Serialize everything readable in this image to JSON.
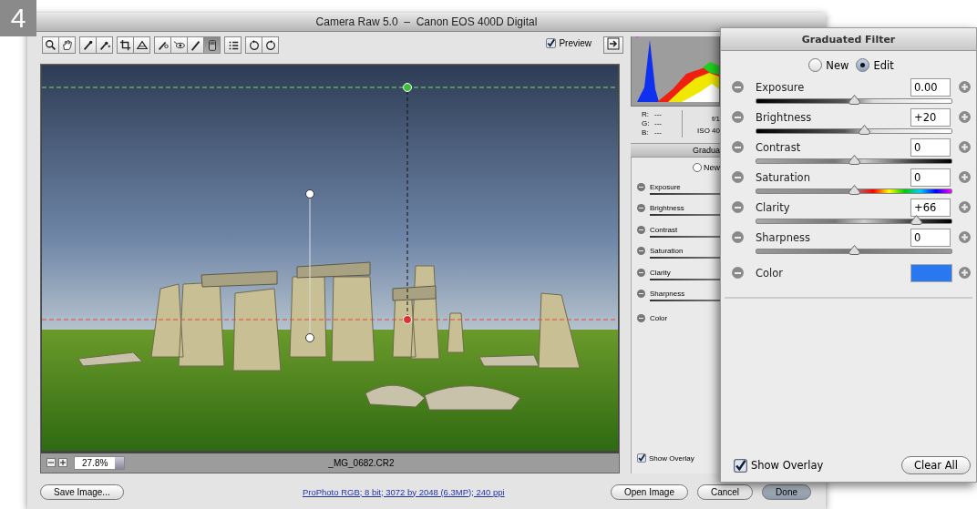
{
  "step_badge": "4",
  "window": {
    "title": "Camera Raw 5.0  –  Canon EOS 400D Digital"
  },
  "toolbar": {
    "tools": [
      {
        "kind": "zoom",
        "selected": false
      },
      {
        "kind": "hand",
        "selected": false
      },
      {
        "kind": "eyedropper",
        "selected": false
      },
      {
        "kind": "sampler",
        "selected": false
      },
      {
        "kind": "crop",
        "selected": false
      },
      {
        "kind": "straighten",
        "selected": false
      },
      {
        "kind": "retouch",
        "selected": false
      },
      {
        "kind": "redeye",
        "selected": false
      },
      {
        "kind": "brush",
        "selected": false
      },
      {
        "kind": "gradient",
        "selected": true
      },
      {
        "kind": "list",
        "selected": false
      },
      {
        "kind": "rotate-left",
        "selected": false
      },
      {
        "kind": "rotate-right",
        "selected": false
      }
    ],
    "preview": {
      "label": "Preview",
      "checked": true
    }
  },
  "image": {
    "zoom": "27.8%",
    "filename": "_MG_0682.CR2"
  },
  "info": {
    "rgb": [
      {
        "label": "R:",
        "value": "---"
      },
      {
        "label": "G:",
        "value": "---"
      },
      {
        "label": "B:",
        "value": "---"
      }
    ],
    "exposure": [
      "f/1",
      "ISO 40"
    ]
  },
  "side_panel": {
    "title": "Gradua",
    "mode": [
      {
        "label": "New",
        "selected": false
      }
    ],
    "rows": [
      "Exposure",
      "Brightness",
      "Contrast",
      "Saturation",
      "Clarity",
      "Sharpness",
      "Color"
    ],
    "show_overlay": {
      "label": "Show Overlay",
      "checked": true
    }
  },
  "footer": {
    "save": "Save Image...",
    "link": "ProPhoto RGB; 8 bit; 3072 by 2048 (6.3MP); 240 ppi",
    "buttons": [
      {
        "label": "Open Image",
        "default": false
      },
      {
        "label": "Cancel",
        "default": false
      },
      {
        "label": "Done",
        "default": true
      }
    ]
  },
  "filter_dialog": {
    "title": "Graduated Filter",
    "mode": [
      {
        "label": "New",
        "selected": false
      },
      {
        "label": "Edit",
        "selected": true
      }
    ],
    "sliders": [
      {
        "label": "Exposure",
        "value": "0.00",
        "level": 0.5,
        "kind": "ramp"
      },
      {
        "label": "Brightness",
        "value": "+20",
        "level": 0.55,
        "kind": "ramp"
      },
      {
        "label": "Contrast",
        "value": "0",
        "level": 0.5,
        "kind": "contrast"
      },
      {
        "label": "Saturation",
        "value": "0",
        "level": 0.5,
        "kind": "spectrum"
      },
      {
        "label": "Clarity",
        "value": "+66",
        "level": 0.82,
        "kind": "contrast"
      },
      {
        "label": "Sharpness",
        "value": "0",
        "level": 0.5,
        "kind": "plain"
      }
    ],
    "color_row": {
      "label": "Color",
      "color": "#2a78f0"
    },
    "show_overlay": {
      "label": "Show Overlay",
      "checked": true
    },
    "clear_button": "Clear All"
  }
}
